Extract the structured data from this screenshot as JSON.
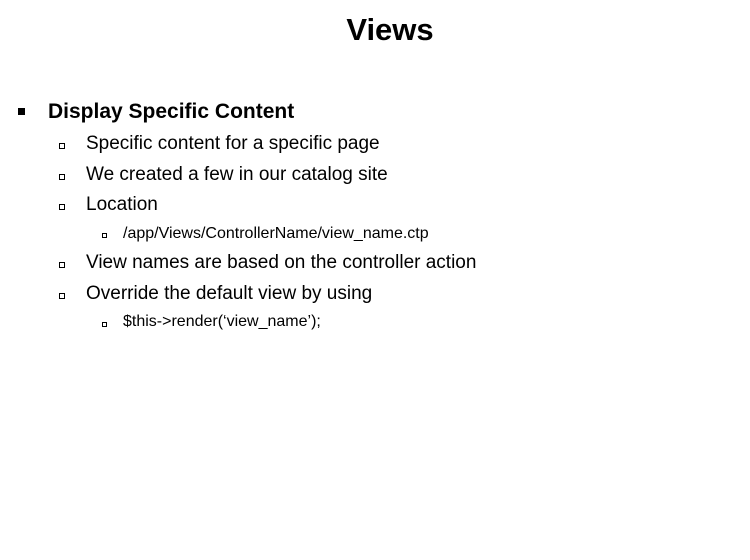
{
  "slide": {
    "title": "Views",
    "bullets": [
      {
        "text": "Display Specific Content"
      },
      {
        "text": "Specific content for a specific page"
      },
      {
        "text": "We created a few in our catalog site"
      },
      {
        "text": "Location"
      },
      {
        "text": "/app/Views/ControllerName/view_name.ctp"
      },
      {
        "text": "View names are based on the controller action"
      },
      {
        "text": "Override the default view by using"
      },
      {
        "text": "$this->render(‘view_name’);"
      }
    ]
  }
}
